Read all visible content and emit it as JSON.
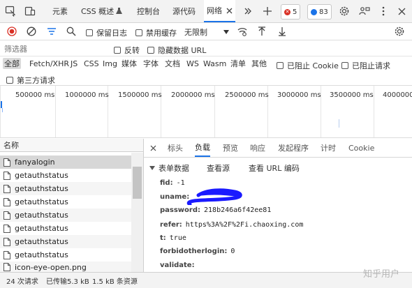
{
  "tabs": {
    "elements": "元素",
    "css_overview": "CSS 概述",
    "console": "控制台",
    "sources": "源代码",
    "network": "网络"
  },
  "badges": {
    "errors": "5",
    "messages": "83"
  },
  "toolbar": {
    "preserve_log": "保留日志",
    "disable_cache": "禁用缓存",
    "throttling": "无限制"
  },
  "filter": {
    "placeholder": "筛选器",
    "invert": "反转",
    "hide_data_urls": "隐藏数据 URL"
  },
  "types": [
    "全部",
    "Fetch/XHR",
    "JS",
    "CSS",
    "Img",
    "媒体",
    "字体",
    "文档",
    "WS",
    "Wasm",
    "清单",
    "其他"
  ],
  "blocked_cookies": "已阻止 Cookie",
  "blocked_requests": "已阻止请求",
  "third_party": "第三方请求",
  "timeline": [
    "500000 ms",
    "1000000 ms",
    "1500000 ms",
    "2000000 ms",
    "2500000 ms",
    "3000000 ms",
    "3500000 ms",
    "4000000"
  ],
  "list": {
    "header": "名称",
    "items": [
      "fanyalogin",
      "getauthstatus",
      "getauthstatus",
      "getauthstatus",
      "getauthstatus",
      "getauthstatus",
      "getauthstatus",
      "getauthstatus",
      "icon-eye-open.png"
    ]
  },
  "detail": {
    "tabs": [
      "标头",
      "负载",
      "预览",
      "响应",
      "发起程序",
      "计时",
      "Cookie"
    ],
    "section_title": "表单数据",
    "view_source": "查看源",
    "view_url_encoded": "查看 URL 编码",
    "fields": [
      {
        "key": "fid:",
        "value": "-1"
      },
      {
        "key": "uname:",
        "value": ""
      },
      {
        "key": "password:",
        "value": "218b246a6f42ee81"
      },
      {
        "key": "refer:",
        "value": "https%3A%2F%2Fi.chaoxing.com"
      },
      {
        "key": "t:",
        "value": "true"
      },
      {
        "key": "forbidotherlogin:",
        "value": "0"
      },
      {
        "key": "validate:",
        "value": ""
      }
    ]
  },
  "status": {
    "requests": "24 次请求",
    "transferred": "已传输5.3 kB",
    "resources": "1.5 kB 条资源"
  },
  "watermark": "知乎用户",
  "colors": {
    "accent": "#1a73e8",
    "error": "#d93025",
    "redaction": "#1a1aff"
  }
}
